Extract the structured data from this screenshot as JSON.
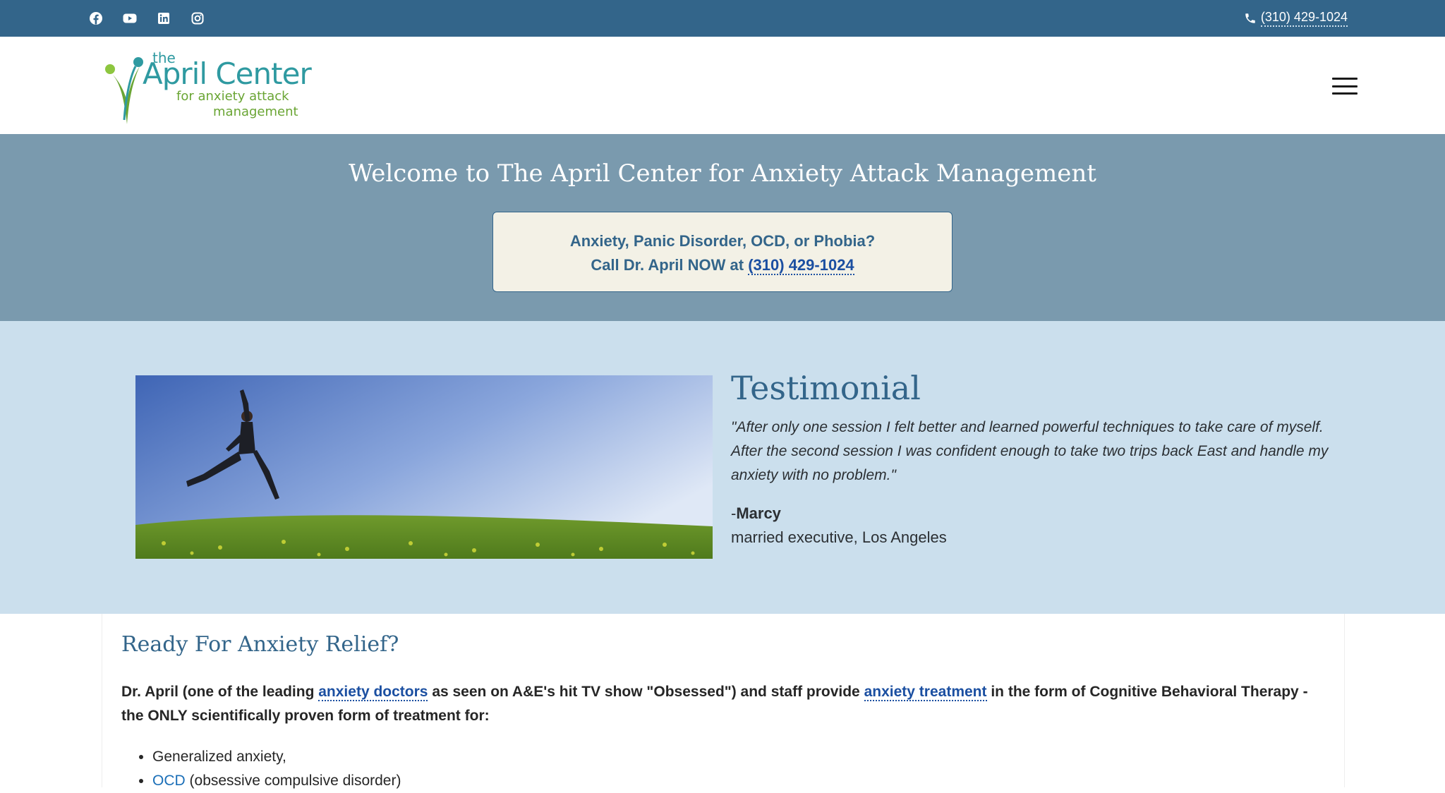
{
  "topbar": {
    "social": [
      {
        "name": "facebook-icon"
      },
      {
        "name": "youtube-icon"
      },
      {
        "name": "linkedin-icon"
      },
      {
        "name": "instagram-icon"
      }
    ],
    "phone": "(310) 429-1024",
    "phone_icon": "phone-icon"
  },
  "header": {
    "logo": {
      "the": "the",
      "brand": "April Center",
      "tagline1": "for anxiety attack",
      "tagline2": "management"
    },
    "menu_icon": "hamburger-menu-icon"
  },
  "welcome": {
    "title": "Welcome to The April Center for Anxiety Attack Management",
    "call_line1": "Anxiety, Panic Disorder, OCD, or Phobia?",
    "call_line2_prefix": "Call Dr. April NOW at",
    "call_phone": "(310) 429-1024"
  },
  "testimonial": {
    "heading": "Testimonial",
    "quote": "\"After only one session I felt better and learned powerful techniques to take care of myself. After the second session I was confident enough to take two trips back East and handle my anxiety with no problem.\"",
    "author_dash": "-",
    "author_name": "Marcy",
    "author_title": "married executive, Los Angeles"
  },
  "content": {
    "heading": "Ready For Anxiety Relief?",
    "intro_part1": "Dr. April (one of the leading",
    "intro_link1": "anxiety doctors",
    "intro_part2": "as seen on A&E's hit TV show \"Obsessed\") and staff provide",
    "intro_link2": "anxiety treatment",
    "intro_part3": "in the form of Cognitive Behavioral Therapy - the ONLY scientifically proven form of treatment for:",
    "list": [
      {
        "text": "Generalized anxiety,",
        "link": "",
        "rest": ""
      },
      {
        "text": "",
        "link": "OCD",
        "rest": "(obsessive compulsive disorder)"
      }
    ]
  },
  "colors": {
    "topbar": "#33658a",
    "welcome_band": "#7a9aae",
    "testimonial_band": "#cbdfed",
    "heading_blue": "#33658a",
    "link_blue": "#1b4fa1",
    "logo_teal": "#2f9aa1",
    "logo_green": "#6aa534"
  }
}
